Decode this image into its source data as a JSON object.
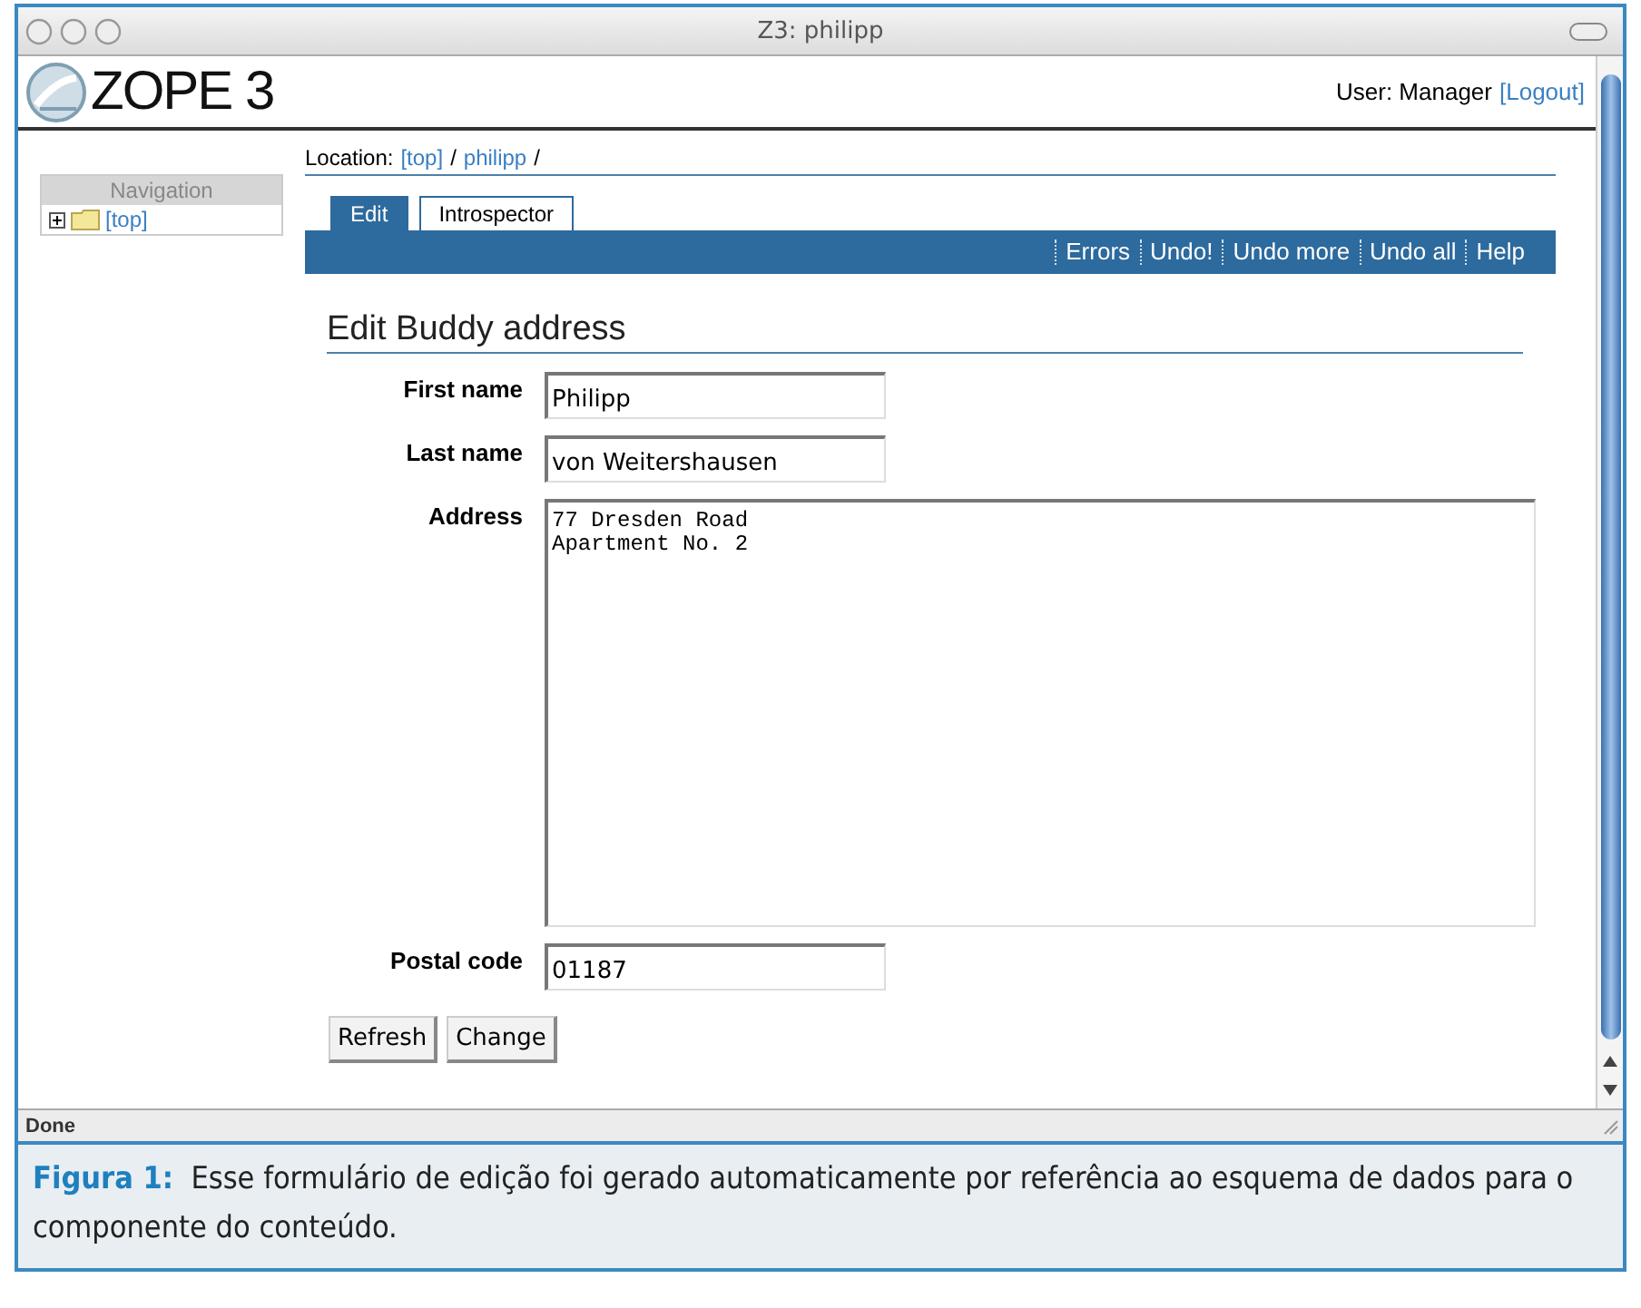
{
  "window": {
    "title": "Z3: philipp"
  },
  "header": {
    "logo": "ZOPE 3",
    "user_label": "User:",
    "user": "Manager",
    "logout": "[Logout]"
  },
  "navigation": {
    "title": "Navigation",
    "items": [
      {
        "label": "[top]",
        "expanded": false
      }
    ]
  },
  "location": {
    "label": "Location:",
    "separator": "/",
    "crumbs": [
      "[top]",
      "philipp"
    ]
  },
  "tabs": [
    {
      "label": "Edit",
      "selected": true
    },
    {
      "label": "Introspector",
      "selected": false
    }
  ],
  "actions": [
    "Errors",
    "Undo!",
    "Undo more",
    "Undo all",
    "Help"
  ],
  "form": {
    "title": "Edit Buddy address",
    "fields": [
      {
        "label": "First name",
        "kind": "input",
        "value": "Philipp"
      },
      {
        "label": "Last name",
        "kind": "input",
        "value": "von Weitershausen"
      },
      {
        "label": "Address",
        "kind": "textarea",
        "value": "77 Dresden Road\nApartment No. 2"
      },
      {
        "label": "Postal code",
        "kind": "input",
        "value": "01187"
      }
    ],
    "buttons": [
      "Refresh",
      "Change"
    ]
  },
  "status_bar": "Done",
  "caption": {
    "label": "Figura 1:",
    "text": "Esse formulário de edição foi gerado automaticamente por referência ao esquema de dados para o componente do conteúdo."
  }
}
